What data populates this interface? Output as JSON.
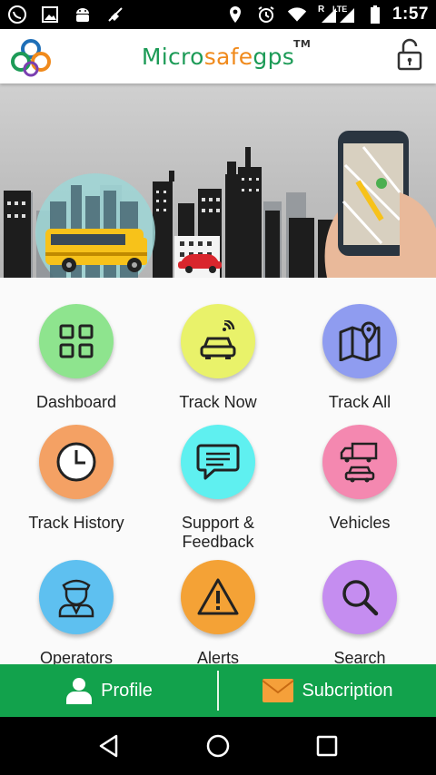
{
  "status_bar": {
    "time": "1:57",
    "icons_left": [
      "whatsapp-icon",
      "image-icon",
      "android-icon",
      "no-sync-icon"
    ],
    "icons_right": [
      "location-icon",
      "alarm-icon",
      "wifi-icon",
      "signal-icon",
      "battery-icon"
    ],
    "network_label": "LTE",
    "roaming_label": "R"
  },
  "header": {
    "brand_part1": "Micro",
    "brand_part2": "safe",
    "brand_part3": "gps",
    "trademark": "TM"
  },
  "tiles": [
    {
      "label": "Dashboard",
      "icon": "grid-icon",
      "color": "#8ee48e"
    },
    {
      "label": "Track Now",
      "icon": "car-signal-icon",
      "color": "#e9f26a"
    },
    {
      "label": "Track All",
      "icon": "map-pin-icon",
      "color": "#8f9cf0"
    },
    {
      "label": "Track History",
      "icon": "clock-icon",
      "color": "#f4a164"
    },
    {
      "label": "Support &\nFeedback",
      "label_line1": "Support &",
      "label_line2": "Feedback",
      "icon": "chat-icon",
      "color": "#5ff0f0"
    },
    {
      "label": "Vehicles",
      "icon": "truck-car-icon",
      "color": "#f488b0"
    },
    {
      "label": "Operators",
      "icon": "operator-icon",
      "color": "#5ec0f0"
    },
    {
      "label": "Alerts",
      "icon": "warning-icon",
      "color": "#f4a236"
    },
    {
      "label": "Search",
      "icon": "search-icon",
      "color": "#c58df0"
    }
  ],
  "bottom_bar": {
    "profile_label": "Profile",
    "subscription_label": "Subcription",
    "color": "#12a24c"
  },
  "colors": {
    "brand_green": "#1d9b57",
    "brand_orange": "#f08a1c"
  }
}
